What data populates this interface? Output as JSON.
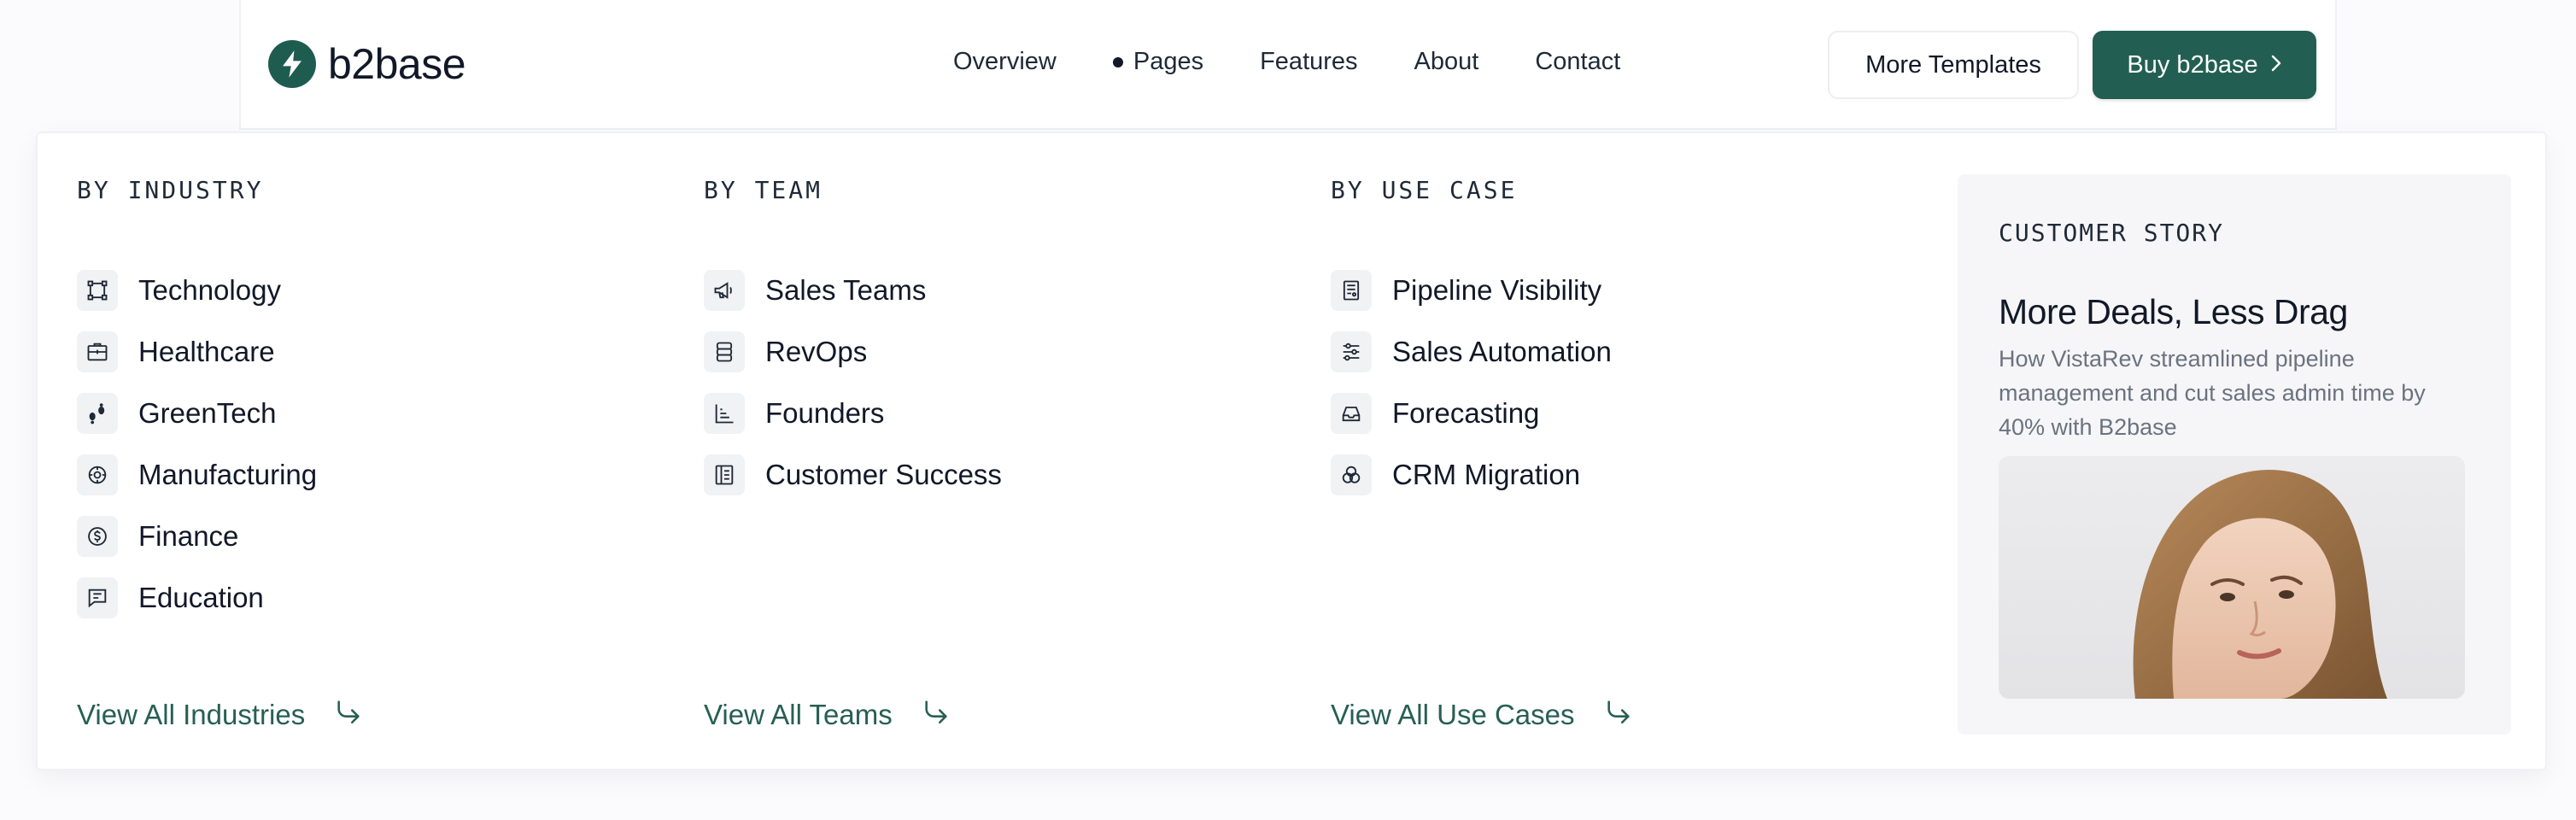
{
  "brand": {
    "name": "b2base"
  },
  "nav": [
    {
      "label": "Overview"
    },
    {
      "label": "Pages"
    },
    {
      "label": "Features"
    },
    {
      "label": "About"
    },
    {
      "label": "Contact"
    }
  ],
  "actions": {
    "more_templates": "More Templates",
    "buy": "Buy b2base"
  },
  "menu": {
    "industry": {
      "title": "BY INDUSTRY",
      "items": [
        {
          "label": "Technology",
          "icon": "network-nodes-icon"
        },
        {
          "label": "Healthcare",
          "icon": "medical-kit-icon"
        },
        {
          "label": "GreenTech",
          "icon": "footprints-icon"
        },
        {
          "label": "Manufacturing",
          "icon": "gear-cycle-icon"
        },
        {
          "label": "Finance",
          "icon": "coin-icon"
        },
        {
          "label": "Education",
          "icon": "chat-board-icon"
        }
      ],
      "view_all": "View All Industries"
    },
    "team": {
      "title": "BY TEAM",
      "items": [
        {
          "label": "Sales Teams",
          "icon": "megaphone-icon"
        },
        {
          "label": "RevOps",
          "icon": "database-icon"
        },
        {
          "label": "Founders",
          "icon": "bar-chart-icon"
        },
        {
          "label": "Customer Success",
          "icon": "book-icon"
        }
      ],
      "view_all": "View All Teams"
    },
    "use_case": {
      "title": "BY USE CASE",
      "items": [
        {
          "label": "Pipeline Visibility",
          "icon": "report-icon"
        },
        {
          "label": "Sales Automation",
          "icon": "sliders-icon"
        },
        {
          "label": "Forecasting",
          "icon": "inbox-tray-icon"
        },
        {
          "label": "CRM Migration",
          "icon": "venn-icon"
        }
      ],
      "view_all": "View All Use Cases"
    }
  },
  "story": {
    "label": "CUSTOMER STORY",
    "title": "More Deals, Less Drag",
    "description": "How VistaRev streamlined pipeline management and cut sales admin time by 40% with B2base"
  },
  "colors": {
    "brand_green": "#225f52",
    "link_green": "#275f53"
  }
}
